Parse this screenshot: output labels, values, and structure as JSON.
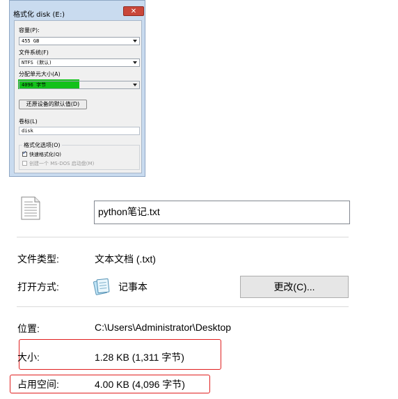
{
  "format_dialog": {
    "title": "格式化 disk (E:)",
    "close_glyph": "✕",
    "capacity_label": "容量(P):",
    "capacity_value": "455 GB",
    "filesystem_label": "文件系统(F)",
    "filesystem_value": "NTFS (默认)",
    "alloc_label": "分配单元大小(A)",
    "alloc_value": "4096 字节",
    "restore_button": "还原设备的默认值(D)",
    "volume_label": "卷标(L)",
    "volume_value": "disk",
    "options_title": "格式化选项(O)",
    "quick_format_label": "快速格式化(Q)",
    "quick_format_checked": true,
    "msdos_label": "创建一个 MS-DOS 启动盘(M)",
    "msdos_checked": false,
    "highlight_color": "#12c11a"
  },
  "properties": {
    "file_icon": "text-file-icon",
    "file_name": "python笔记.txt",
    "type_label": "文件类型:",
    "type_value": "文本文档 (.txt)",
    "open_with_label": "打开方式:",
    "open_with_icon": "notepad-icon",
    "open_with_app": "记事本",
    "change_button": "更改(C)...",
    "location_label": "位置:",
    "location_value": "C:\\Users\\Administrator\\Desktop",
    "size_label": "大小:",
    "size_value": "1.28 KB (1,311 字节)",
    "size_on_disk_label": "占用空间:",
    "size_on_disk_value": "4.00 KB (4,096 字节)",
    "annotation_color": "#e01e1e"
  }
}
